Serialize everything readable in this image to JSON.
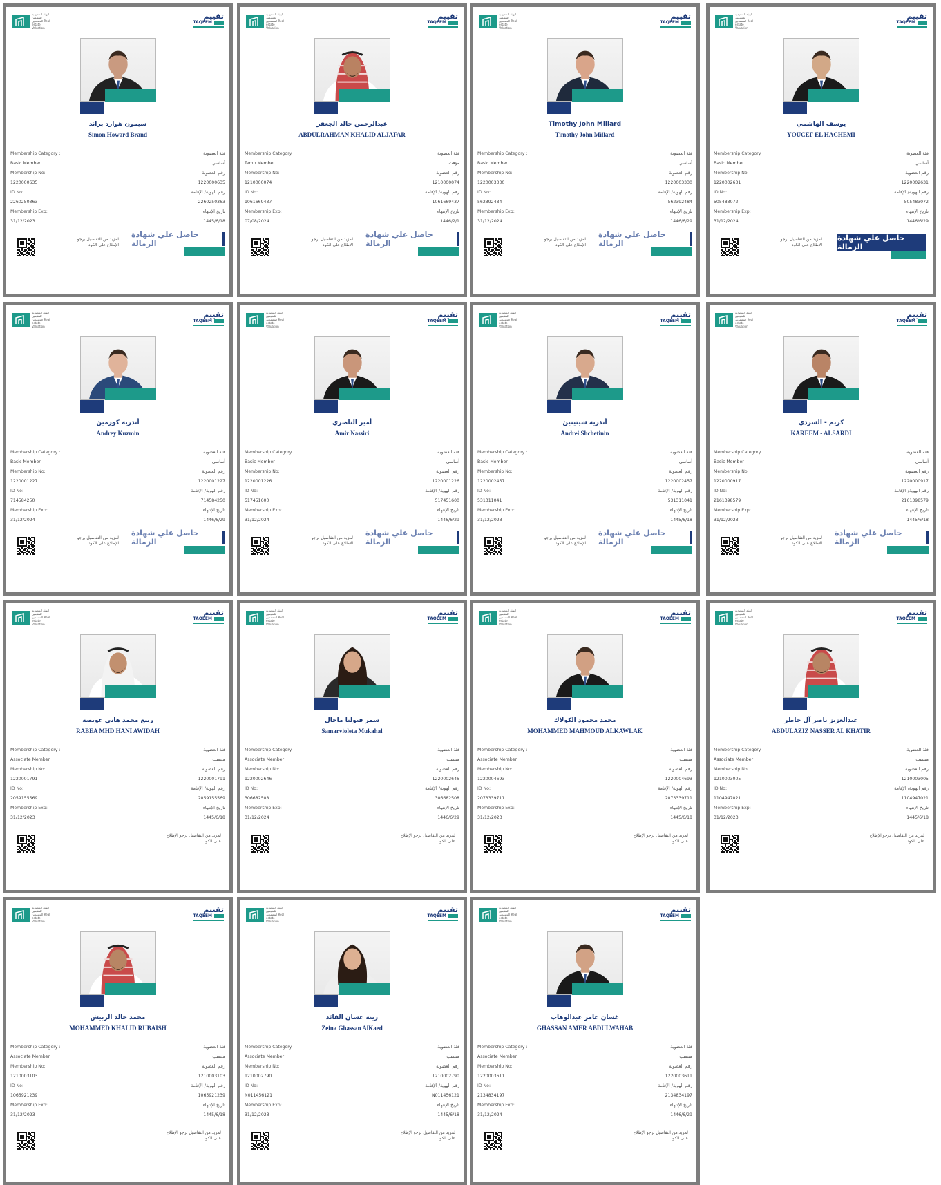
{
  "brand": {
    "logo_left_text": "الهيئة السعودية للمقيمين المعتمدين Real estate Valuation",
    "logo_right_ar": "تقييم",
    "logo_right_en": "TAQEEM"
  },
  "labels": {
    "category_en": "Membership Category :",
    "category_ar": "فئة العضوية",
    "no_en": "Membership No:",
    "no_ar": "رقم العضوية",
    "id_en": "ID No:",
    "id_ar": "رقم الهوية/ الإقامة",
    "exp_en": "Membership Exp:",
    "exp_ar": "تاريخ الإنتهاء",
    "more": "لمزيد من التفاصيل برجو الإطلاع على الكود",
    "badge": "حاصل علي شهادة الزمالة"
  },
  "colors": {
    "navy": "#1e3b7a",
    "teal": "#1d9a8a",
    "border": "#7d7d7d"
  },
  "cards": [
    {
      "name_ar": "سيمون هوارد براند",
      "name_en": "Simon Howard Brand",
      "cat_en": "Basic Member",
      "cat_ar": "أساسي",
      "no": "1220000635",
      "id": "2260250363",
      "exp": "31/12/2023",
      "exp_h": "1445/6/18",
      "badge": true,
      "badge_style": "light",
      "suit": "#222",
      "skin": "#c99a80",
      "head": "none"
    },
    {
      "name_ar": "عبدالرحمن خالد الجعفر",
      "name_en": "ABDULRAHMAN KHALID ALJAFAR",
      "cat_en": "Temp Member",
      "cat_ar": "مؤقت",
      "no": "1210000074",
      "id": "1061669437",
      "exp": "07/08/2024",
      "exp_h": "1446/2/1",
      "badge": true,
      "badge_style": "light",
      "suit": "#ffffff",
      "skin": "#b98262",
      "head": "shemagh-red"
    },
    {
      "name_ar": "",
      "name_en": "Timothy John Millard",
      "name_en2": "Timothy John Millard",
      "cat_en": "Basic Member",
      "cat_ar": "أساسي",
      "no": "1220003330",
      "id": "562392484",
      "exp": "31/12/2024",
      "exp_h": "1446/6/29",
      "badge": true,
      "badge_style": "light",
      "suit": "#1f2a3c",
      "skin": "#d9a58a",
      "head": "none"
    },
    {
      "name_ar": "يوسف الهاشمي",
      "name_en": "YOUCEF EL HACHEMI",
      "cat_en": "Basic Member",
      "cat_ar": "أساسي",
      "no": "1220002631",
      "id": "505483072",
      "exp": "31/12/2024",
      "exp_h": "1446/6/29",
      "badge": true,
      "badge_style": "solid",
      "suit": "#1a1a1a",
      "skin": "#d2a887",
      "head": "none"
    },
    {
      "name_ar": "أندريه كوزمين",
      "name_en": "Andrey Kuzmin",
      "cat_en": "Basic Member",
      "cat_ar": "أساسي",
      "no": "1220001227",
      "id": "714584250",
      "exp": "31/12/2024",
      "exp_h": "1446/6/29",
      "badge": true,
      "badge_style": "light",
      "suit": "#2b4a7a",
      "skin": "#e0b39a",
      "head": "none"
    },
    {
      "name_ar": "أمير الناصري",
      "name_en": "Amir Nassiri",
      "cat_en": "Basic Member",
      "cat_ar": "أساسي",
      "no": "1220001226",
      "id": "517451600",
      "exp": "31/12/2024",
      "exp_h": "1446/6/29",
      "badge": true,
      "badge_style": "light",
      "suit": "#1a1a1a",
      "skin": "#c9967a",
      "head": "none"
    },
    {
      "name_ar": "أندريه شيتينين",
      "name_en": "Andrei Shchetinin",
      "cat_en": "Basic Member",
      "cat_ar": "أساسي",
      "no": "1220002457",
      "id": "531311041",
      "exp": "31/12/2023",
      "exp_h": "1445/6/18",
      "badge": true,
      "badge_style": "light",
      "suit": "#23304a",
      "skin": "#d8a98d",
      "head": "none"
    },
    {
      "name_ar": "كريم - السردي",
      "name_en": "KAREEM - ALSARDI",
      "cat_en": "Basic Member",
      "cat_ar": "أساسي",
      "no": "1220000917",
      "id": "2161398579",
      "exp": "31/12/2023",
      "exp_h": "1445/6/18",
      "badge": true,
      "badge_style": "light",
      "suit": "#1a1a1a",
      "skin": "#b98466",
      "head": "none"
    },
    {
      "name_ar": "ربيع محمد هاني عويضه",
      "name_en": "RABEA MHD HANI AWIDAH",
      "cat_en": "Associate Member",
      "cat_ar": "منتسب",
      "no": "1220001791",
      "id": "2059155569",
      "exp": "31/12/2023",
      "exp_h": "1445/6/18",
      "badge": false,
      "suit": "#ffffff",
      "skin": "#c2906f",
      "head": "shemagh-white"
    },
    {
      "name_ar": "سمر فيولتا ماخال",
      "name_en": "Samarvioleta Mukahal",
      "cat_en": "Associate Member",
      "cat_ar": "منتسب",
      "no": "1220002646",
      "id": "306682508",
      "exp": "31/12/2024",
      "exp_h": "1446/6/29",
      "badge": false,
      "suit": "#2a2a2a",
      "skin": "#d6a789",
      "head": "hair-long"
    },
    {
      "name_ar": "محمد محمود الكولاك",
      "name_en": "MOHAMMED MAHMOUD ALKAWLAK",
      "cat_en": "Associate Member",
      "cat_ar": "منتسب",
      "no": "1220004693",
      "id": "2073339711",
      "exp": "31/12/2023",
      "exp_h": "1445/6/18",
      "badge": false,
      "suit": "#1a1a1a",
      "skin": "#d1a083",
      "head": "none"
    },
    {
      "name_ar": "عبدالعزيز ناصر آل خاطر",
      "name_en": "ABDULAZIZ NASSER AL KHATIR",
      "cat_en": "Associate Member",
      "cat_ar": "منتسب",
      "no": "1210003005",
      "id": "1104947021",
      "exp": "31/12/2023",
      "exp_h": "1445/6/18",
      "badge": false,
      "suit": "#ffffff",
      "skin": "#b88564",
      "head": "shemagh-red"
    },
    {
      "name_ar": "محمد خالد الربيش",
      "name_en": "MOHAMMED KHALID RUBAISH",
      "cat_en": "Associate Member",
      "cat_ar": "منتسب",
      "no": "1210003103",
      "id": "1065921239",
      "exp": "31/12/2023",
      "exp_h": "1445/6/18",
      "badge": false,
      "suit": "#ffffff",
      "skin": "#b88564",
      "head": "shemagh-red"
    },
    {
      "name_ar": "زينة غسان القائد",
      "name_en": "Zeina Ghassan AlKaed",
      "cat_en": "Associate Member",
      "cat_ar": "منتسب",
      "no": "1210002790",
      "id": "N011456121",
      "exp": "31/12/2023",
      "exp_h": "1445/6/18",
      "badge": false,
      "suit": "#eeeeee",
      "skin": "#ddb092",
      "head": "hair-long"
    },
    {
      "name_ar": "غسان عامر عبدالوهاب",
      "name_en": "GHASSAN AMER ABDULWAHAB",
      "cat_en": "Associate Member",
      "cat_ar": "منتسب",
      "no": "1220003611",
      "id": "2134834197",
      "exp": "31/12/2024",
      "exp_h": "1446/6/29",
      "badge": false,
      "suit": "#1a1a1a",
      "skin": "#d2a285",
      "head": "none"
    }
  ]
}
